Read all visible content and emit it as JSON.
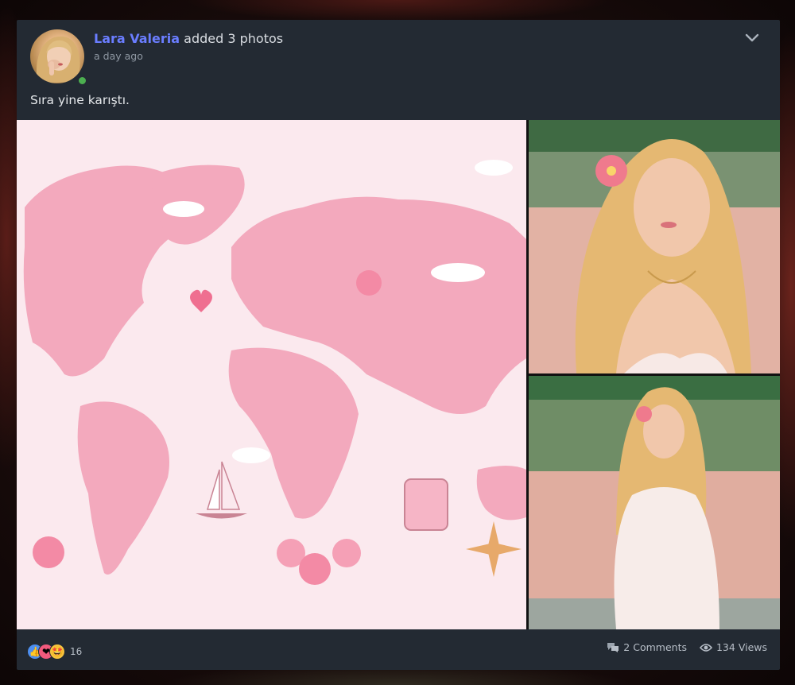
{
  "post": {
    "author": "Lara Valeria",
    "action": "added 3 photos",
    "timestamp": "a day ago",
    "text": "Sıra yine karıştı.",
    "online": true
  },
  "photos": [
    {
      "icon": "world-map-illustration-photo"
    },
    {
      "icon": "sim-character-portrait-photo"
    },
    {
      "icon": "sim-character-sitting-photo"
    }
  ],
  "footer": {
    "reactions": [
      "like-icon",
      "love-icon",
      "star-struck-icon"
    ],
    "reaction_count": "16",
    "comments": "2 Comments",
    "views": "134 Views"
  },
  "colors": {
    "card_bg": "#232a33",
    "author_link": "#6a7dff",
    "online_dot": "#4caf50"
  }
}
